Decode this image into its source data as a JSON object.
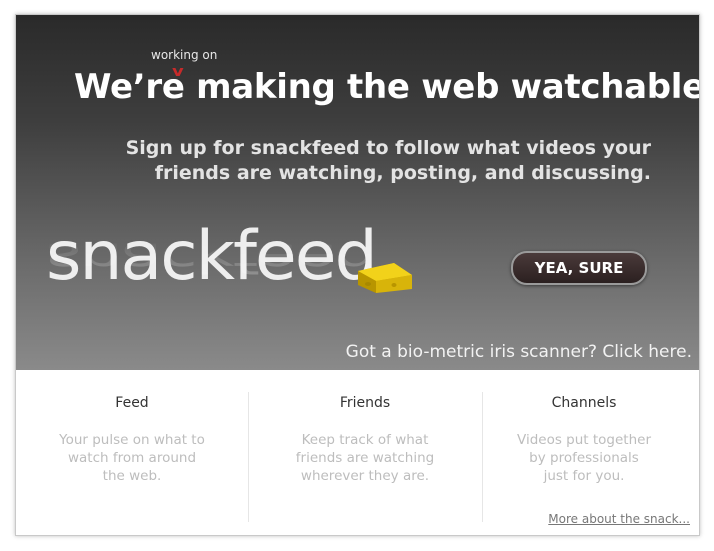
{
  "hero": {
    "annotation": "working on",
    "caret": "v",
    "headline": "We’re making the web watchable.",
    "subhead_line1": "Sign up for snackfeed to follow what videos your",
    "subhead_line2": "friends are watching, posting, and discussing.",
    "logo": "snackfeed",
    "cta_label": "YEA, SURE",
    "iris_link": "Got a bio-metric iris scanner? Click here."
  },
  "features": [
    {
      "title": "Feed",
      "line1": "Your pulse on what to",
      "line2": "watch from around",
      "line3": "the web."
    },
    {
      "title": "Friends",
      "line1": "Keep track of what",
      "line2": "friends are watching",
      "line3": "wherever they are."
    },
    {
      "title": "Channels",
      "line1": "Videos put together",
      "line2": "by professionals",
      "line3": "just for you."
    }
  ],
  "more_link": "More about the snack..."
}
